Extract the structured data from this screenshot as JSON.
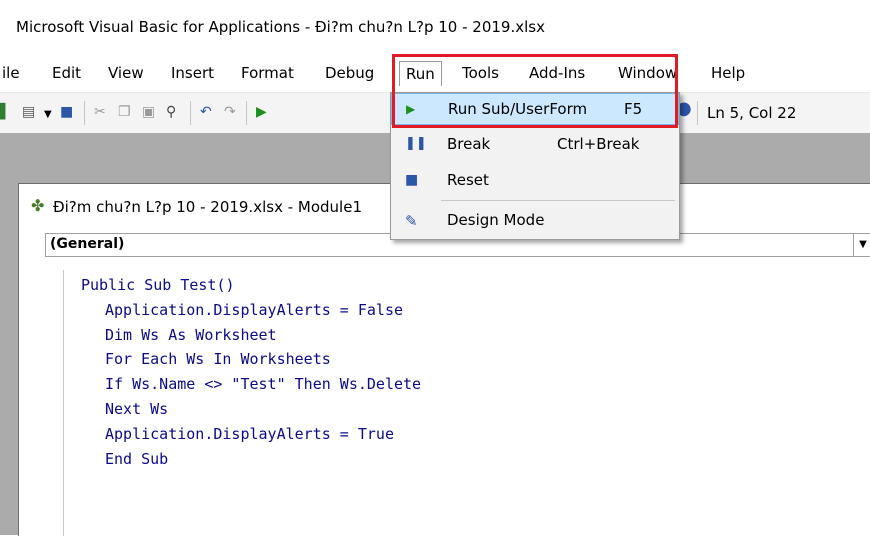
{
  "window": {
    "title": "Microsoft Visual Basic for Applications - Đi?m chu?n L?p 10 - 2019.xlsx"
  },
  "menubar": {
    "items": [
      "ile",
      "Edit",
      "View",
      "Insert",
      "Format",
      "Debug",
      "Run",
      "Tools",
      "Add-Ins",
      "Window",
      "Help"
    ]
  },
  "toolbar": {
    "status": "Ln 5, Col 22"
  },
  "run_menu": {
    "items": [
      {
        "label": "Run Sub/UserForm",
        "shortcut": "F5",
        "icon": "play-icon"
      },
      {
        "label": "Break",
        "shortcut": "Ctrl+Break",
        "icon": "pause-icon"
      },
      {
        "label": "Reset",
        "shortcut": "",
        "icon": "stop-icon"
      },
      {
        "label": "Design Mode",
        "shortcut": "",
        "icon": "design-mode-icon"
      }
    ]
  },
  "code_window": {
    "title": "Đi?m chu?n L?p 10 - 2019.xlsx - Module1",
    "object_combo": "(General)",
    "lines": [
      "Public Sub Test()",
      "Application.DisplayAlerts = False",
      "Dim Ws As Worksheet",
      "For Each Ws In Worksheets",
      "If Ws.Name <> \"Test\" Then Ws.Delete",
      "Next Ws",
      "Application.DisplayAlerts = True",
      "End Sub"
    ]
  },
  "colors": {
    "highlight": "#e01b24",
    "menu_selected": "#cce8ff",
    "code_text": "#0b0b8a"
  }
}
